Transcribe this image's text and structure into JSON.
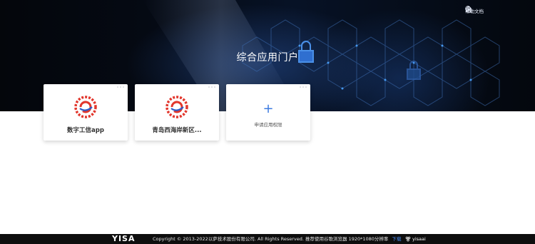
{
  "header": {
    "help_label": "帮助文档",
    "help_icon": "question-circle-icon",
    "user_icon": "user-icon",
    "power_icon": "power-icon",
    "title": "综合应用门户"
  },
  "apps": [
    {
      "name": "数字工信app",
      "icon": "yisa-app-logo-icon"
    },
    {
      "name": "青岛西海岸新区...",
      "icon": "yisa-app-logo-icon"
    }
  ],
  "apply_card": {
    "plus": "+",
    "label": "申请应用权限"
  },
  "footer": {
    "logo_text": "YISA",
    "copyright": "Copyright © 2013-2022以萨技术股份有限公司. All Rights Reserved. 推荐使用谷歌浏览器 1920*1080分辨率",
    "download_label": "下载",
    "brand_logo_text": "yisaai"
  },
  "colors": {
    "accent": "#3d7be0",
    "hero_bg": "#050a14",
    "footer_bg": "#0e0e0e",
    "link": "#4d8ff5"
  }
}
